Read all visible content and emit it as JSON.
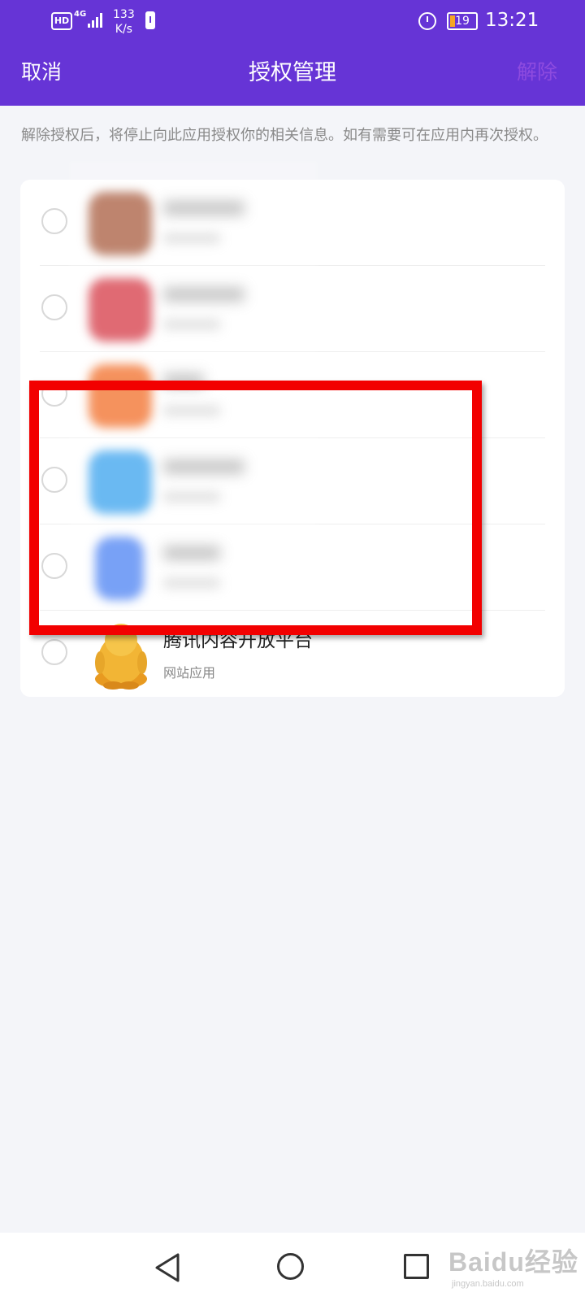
{
  "status_bar": {
    "hd": "HD",
    "network": "4G",
    "speed_value": "133",
    "speed_unit": "K/s",
    "battery_level": "19",
    "time": "13:21"
  },
  "header": {
    "cancel": "取消",
    "title": "授权管理",
    "remove": "解除"
  },
  "description": "解除授权后，将停止向此应用授权你的相关信息。如有需要可在应用内再次授权。",
  "apps": [
    {
      "name": "",
      "subtitle": "",
      "icon_color": "#b06a4f",
      "blurred": true
    },
    {
      "name": "",
      "subtitle": "",
      "icon_color": "#d94a55",
      "blurred": true
    },
    {
      "name": "",
      "subtitle": "",
      "icon_color": "#f37a3a",
      "blurred": true
    },
    {
      "name": "",
      "subtitle": "",
      "icon_color": "#4aaaf0",
      "blurred": true
    },
    {
      "name": "",
      "subtitle": "",
      "icon_color": "#5b8df5",
      "blurred": true
    },
    {
      "name": "腾讯内容开放平台",
      "subtitle": "网站应用",
      "icon_color": "#f0b23a",
      "blurred": false
    }
  ],
  "watermark": {
    "main": "Baidu经验",
    "url": "jingyan.baidu.com"
  },
  "colors": {
    "brand": "#6634d6",
    "highlight": "#f20000",
    "background": "#f4f5f9"
  }
}
